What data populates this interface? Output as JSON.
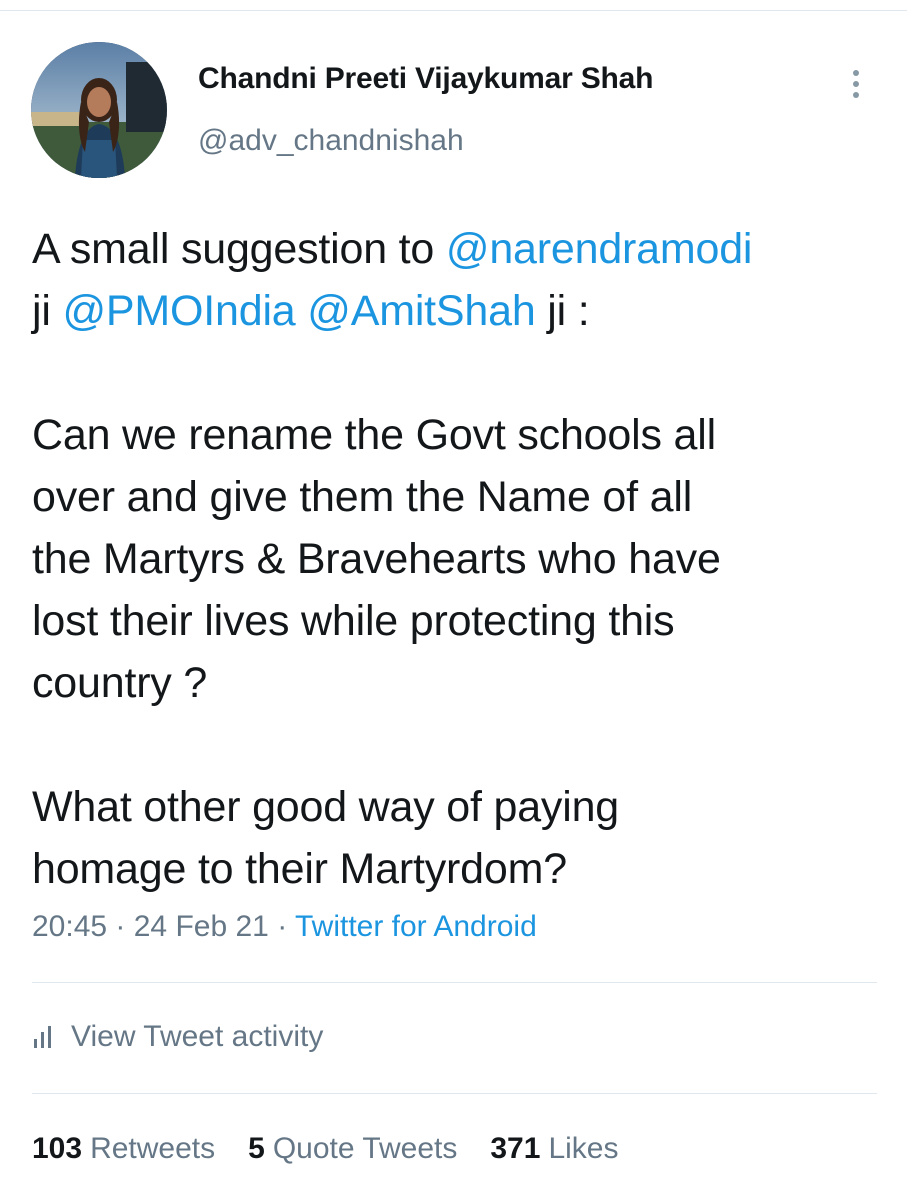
{
  "author": {
    "display_name": "Chandni Preeti Vijaykumar Shah",
    "handle": "@adv_chandnishah",
    "avatar_icon": "profile-photo"
  },
  "more_icon": "more-vertical-icon",
  "tweet": {
    "lines": [
      [
        {
          "text": "A small suggestion to ",
          "type": "text"
        },
        {
          "text": "@narendramodi",
          "type": "mention"
        }
      ],
      [
        {
          "text": "ji ",
          "type": "text"
        },
        {
          "text": "@PMOIndia",
          "type": "mention"
        },
        {
          "text": " ",
          "type": "text"
        },
        {
          "text": "@AmitShah",
          "type": "mention"
        },
        {
          "text": " ji :",
          "type": "text"
        }
      ],
      [],
      [
        {
          "text": "Can we rename the Govt schools all",
          "type": "text"
        }
      ],
      [
        {
          "text": "over and give them the Name of all",
          "type": "text"
        }
      ],
      [
        {
          "text": "the Martyrs & Bravehearts who have",
          "type": "text"
        }
      ],
      [
        {
          "text": "lost their lives while protecting this",
          "type": "text"
        }
      ],
      [
        {
          "text": "country ?",
          "type": "text"
        }
      ],
      [],
      [
        {
          "text": "What other good way of paying",
          "type": "text"
        }
      ],
      [
        {
          "text": "homage to their Martyrdom?",
          "type": "text"
        }
      ]
    ]
  },
  "meta": {
    "time": "20:45",
    "separator": " · ",
    "date": "24 Feb 21",
    "source": "Twitter for Android"
  },
  "activity": {
    "label": "View Tweet activity",
    "icon": "bar-chart-icon"
  },
  "stats": {
    "retweets_count": "103",
    "retweets_label": "Retweets",
    "quotes_count": "5",
    "quotes_label": "Quote Tweets",
    "likes_count": "371",
    "likes_label": "Likes"
  },
  "colors": {
    "link": "#1b95e0",
    "secondary_text": "#657786",
    "primary_text": "#14171a",
    "divider": "#e1e8ed"
  }
}
